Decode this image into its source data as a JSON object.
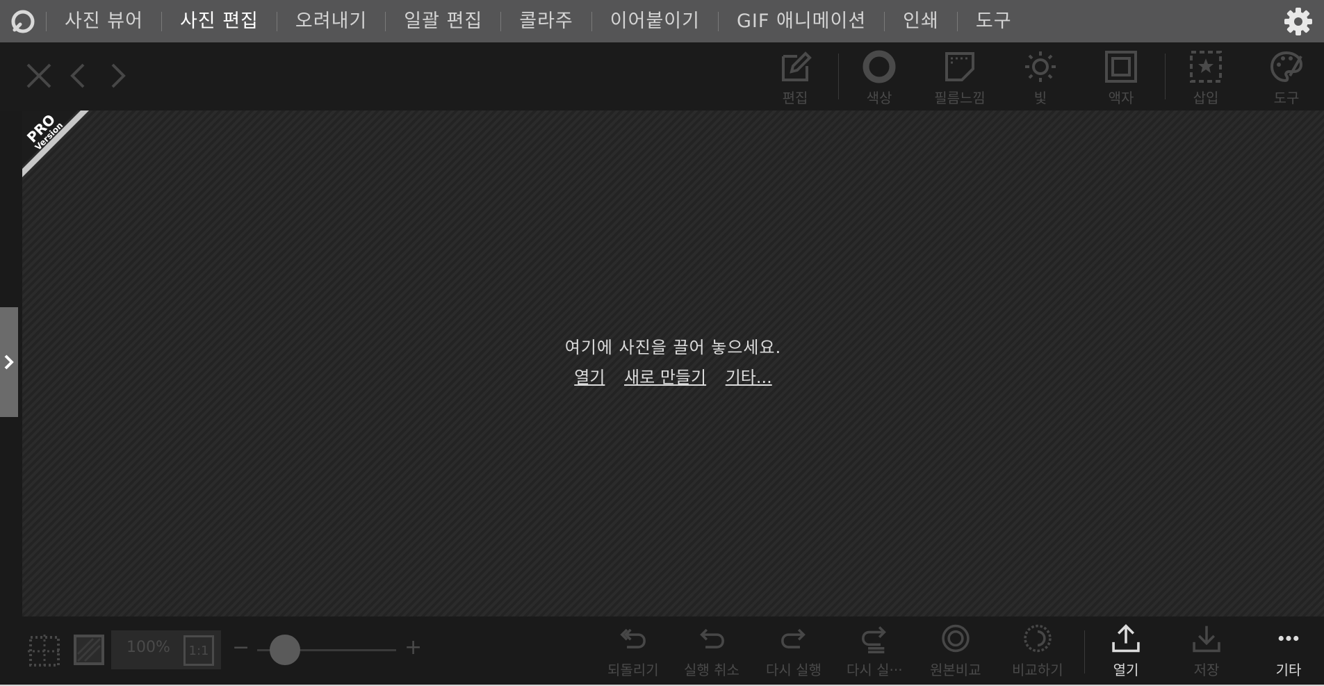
{
  "menu": {
    "items": [
      {
        "label": "사진 뷰어",
        "active": false
      },
      {
        "label": "사진 편집",
        "active": true
      },
      {
        "label": "오려내기",
        "active": false
      },
      {
        "label": "일괄 편집",
        "active": false
      },
      {
        "label": "콜라주",
        "active": false
      },
      {
        "label": "이어붙이기",
        "active": false
      },
      {
        "label": "GIF 애니메이션",
        "active": false
      },
      {
        "label": "인쇄",
        "active": false
      },
      {
        "label": "도구",
        "active": false
      }
    ]
  },
  "toolbar": {
    "tools": [
      {
        "label": "편집",
        "icon": "edit-icon"
      },
      {
        "label": "색상",
        "icon": "color-ring-icon"
      },
      {
        "label": "필름느낌",
        "icon": "film-icon"
      },
      {
        "label": "빛",
        "icon": "sun-icon"
      },
      {
        "label": "액자",
        "icon": "frame-icon"
      },
      {
        "label": "삽입",
        "icon": "insert-star-icon"
      },
      {
        "label": "도구",
        "icon": "palette-icon"
      }
    ]
  },
  "canvas": {
    "badge_line1": "PRO",
    "badge_line2": "Version",
    "drop_message": "여기에 사진을 끌어 놓으세요.",
    "links": {
      "open": "열기",
      "new": "새로 만들기",
      "more": "기타..."
    }
  },
  "bottom": {
    "zoom": "100%",
    "ratio": "1:1",
    "zoom_level": 0.2,
    "minus": "−",
    "plus": "+",
    "actions": [
      {
        "label": "되돌리기",
        "icon": "revert-icon"
      },
      {
        "label": "실행 취소",
        "icon": "undo-icon"
      },
      {
        "label": "다시 실행",
        "icon": "redo-icon"
      },
      {
        "label": "다시 실···",
        "icon": "redo-all-icon"
      },
      {
        "label": "원본비교",
        "icon": "compare-original-icon"
      },
      {
        "label": "비교하기",
        "icon": "compare-icon"
      }
    ],
    "open_label": "열기",
    "save_label": "저장",
    "more_label": "기타"
  }
}
